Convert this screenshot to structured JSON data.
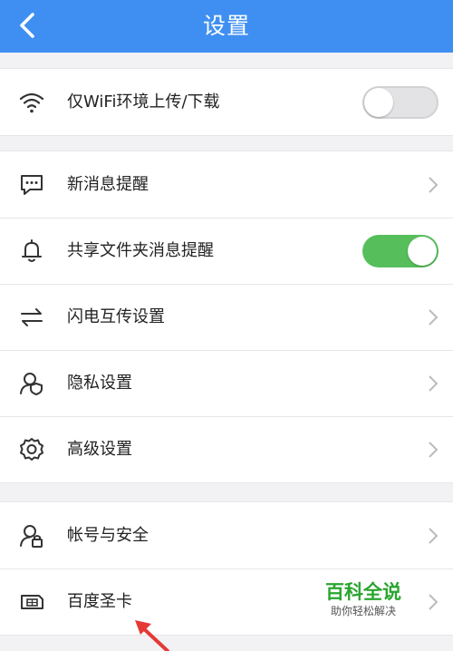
{
  "header": {
    "title": "设置"
  },
  "section1": {
    "items": [
      {
        "label": "仅WiFi环境上传/下载",
        "icon": "wifi-icon",
        "toggle": "off"
      }
    ]
  },
  "section2": {
    "items": [
      {
        "label": "新消息提醒",
        "icon": "message-icon"
      },
      {
        "label": "共享文件夹消息提醒",
        "icon": "bell-icon",
        "toggle": "on"
      },
      {
        "label": "闪电互传设置",
        "icon": "transfer-icon"
      },
      {
        "label": "隐私设置",
        "icon": "privacy-icon"
      },
      {
        "label": "高级设置",
        "icon": "gear-icon"
      }
    ]
  },
  "section3": {
    "items": [
      {
        "label": "帐号与安全",
        "icon": "account-lock-icon"
      },
      {
        "label": "百度圣卡",
        "icon": "sim-card-icon"
      }
    ]
  },
  "watermark": {
    "main": "百科全说",
    "sub": "助你轻松解决"
  },
  "colors": {
    "header": "#3f8ff2",
    "toggle_on": "#56bf5c",
    "watermark": "#2aa52e",
    "arrow": "#e53935"
  }
}
